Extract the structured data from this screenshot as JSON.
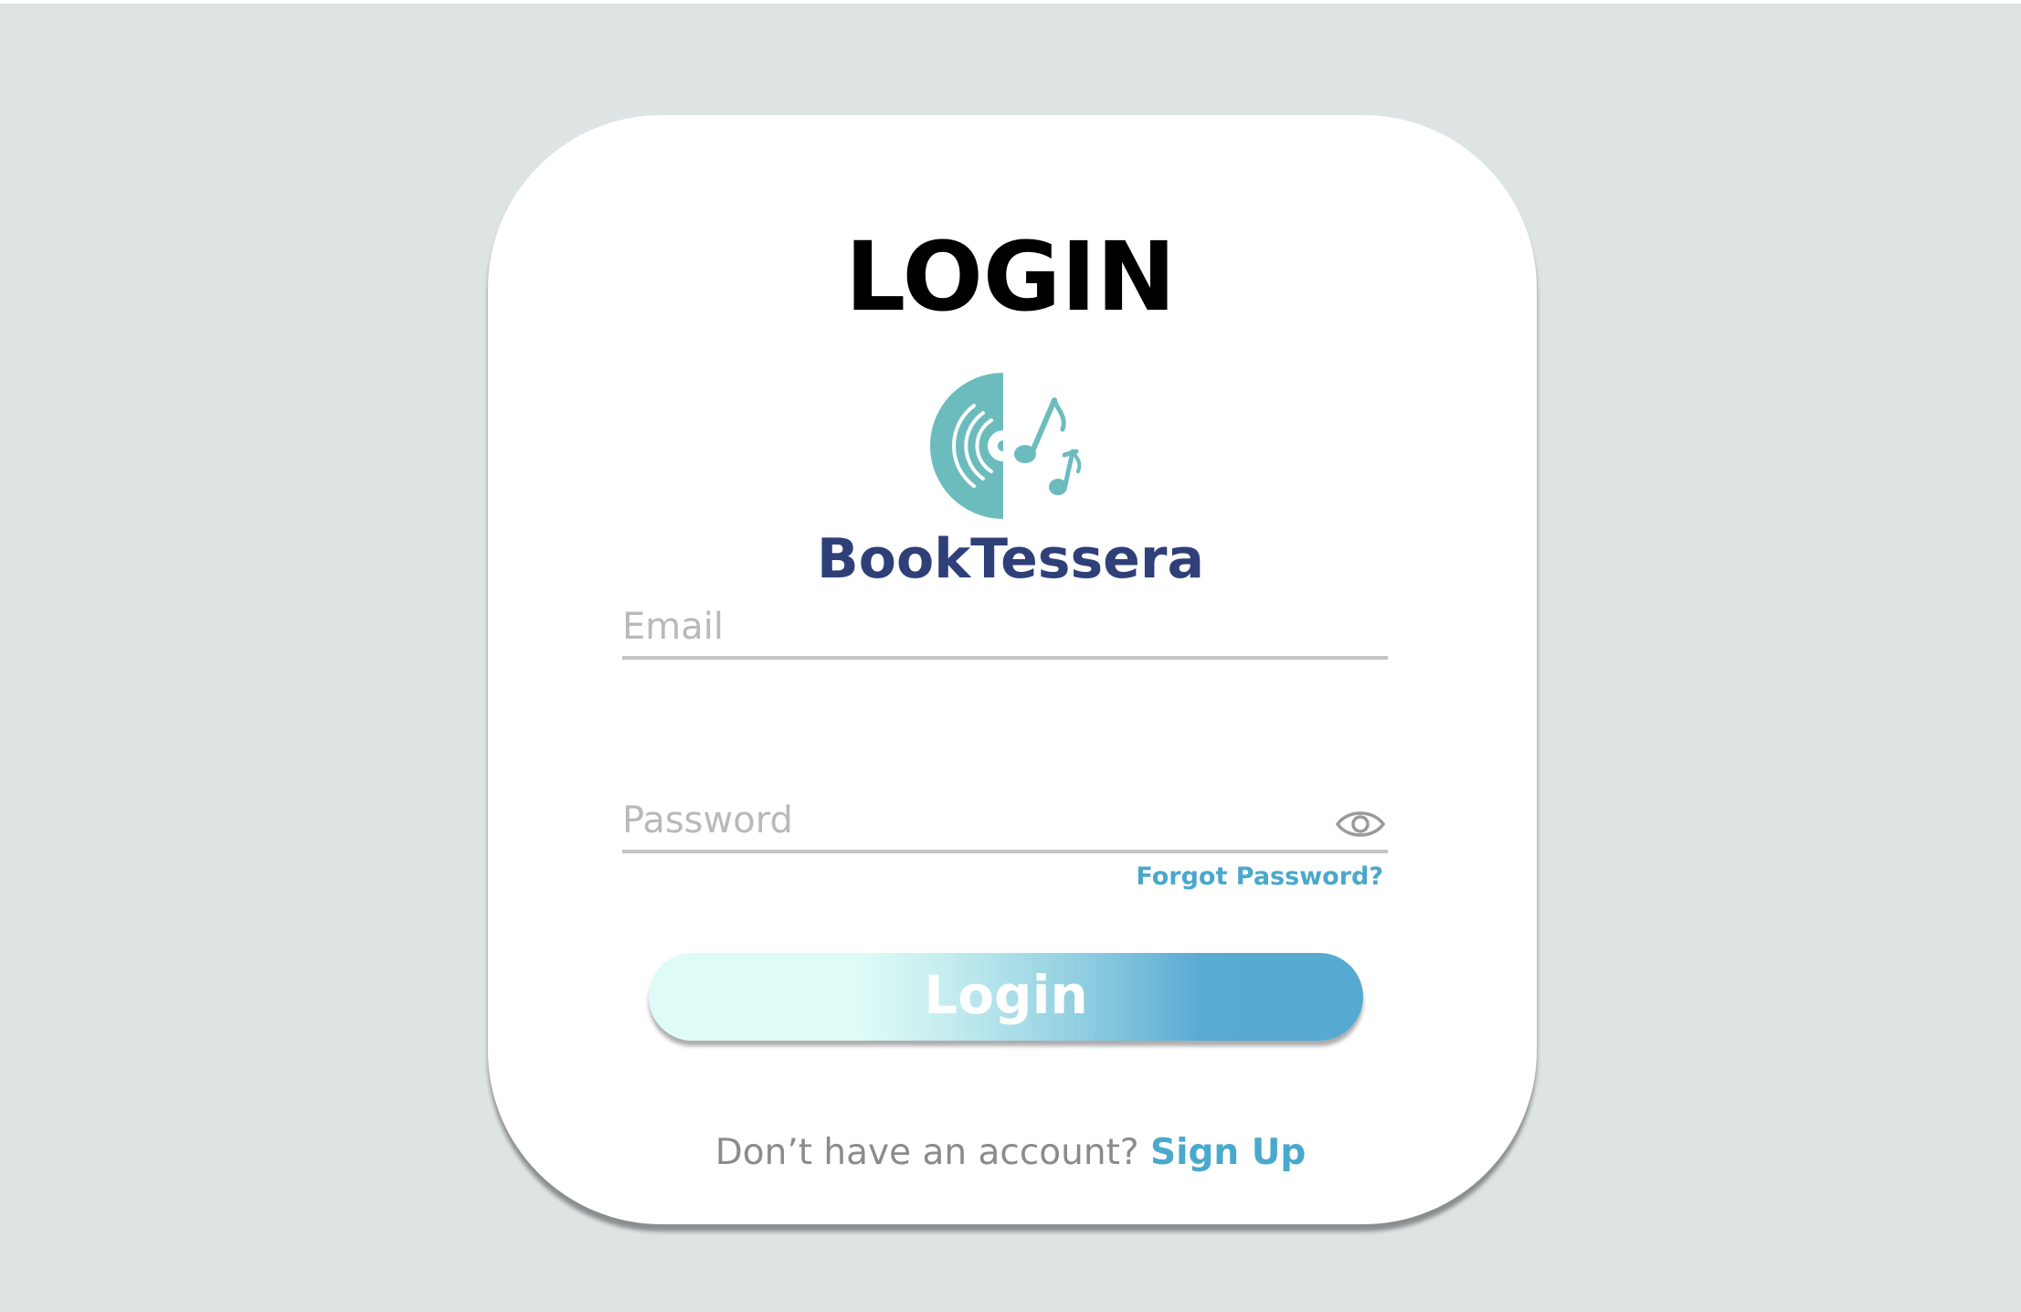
{
  "login": {
    "title": "LOGIN",
    "brand_name": "BookTessera",
    "logo_icon": "vinyl-record-music-notes-icon",
    "email": {
      "placeholder": "Email",
      "value": ""
    },
    "password": {
      "placeholder": "Password",
      "value": "",
      "toggle_icon": "eye-icon"
    },
    "forgot_password_label": "Forgot Password?",
    "login_button_label": "Login",
    "signup_prompt": "Don’t have an account?",
    "signup_link_label": "Sign Up"
  },
  "colors": {
    "page_background": "#dee4e4",
    "card_background": "#ffffff",
    "brand_text": "#2f3f78",
    "logo_teal": "#6cbcbe",
    "link_blue": "#4aa8cc",
    "placeholder_gray": "#b9b9b9",
    "button_gradient_start": "#dffbf7",
    "button_gradient_end": "#56a9d1"
  }
}
